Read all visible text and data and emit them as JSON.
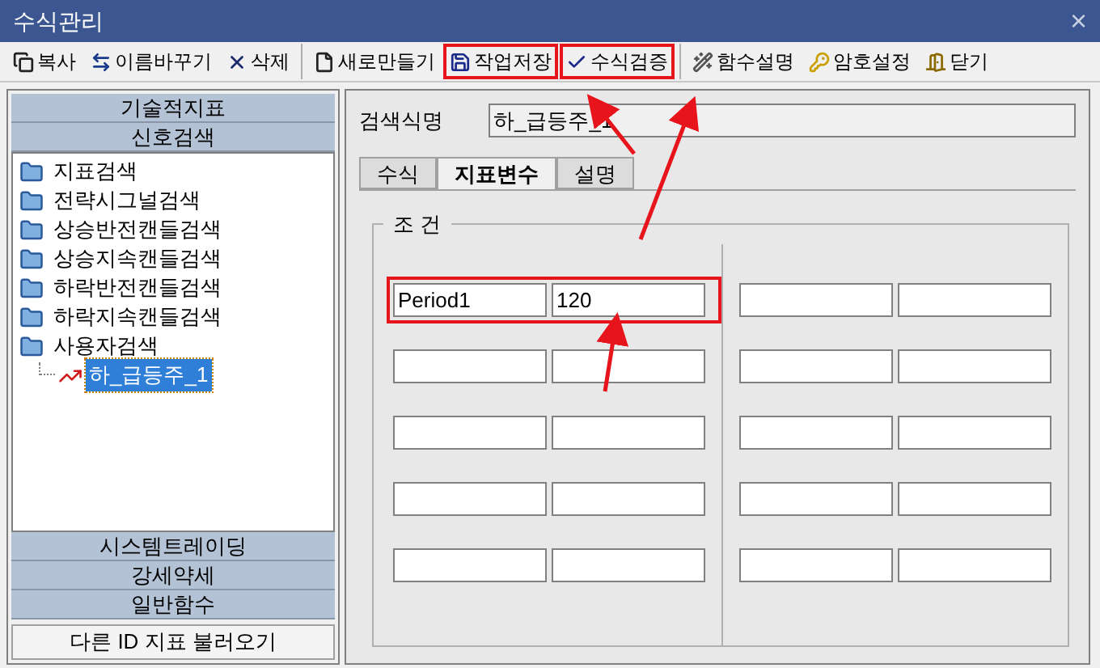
{
  "window": {
    "title": "수식관리",
    "close": "×"
  },
  "toolbar": [
    [
      {
        "label": "복사",
        "highlighted": false
      },
      {
        "label": "이름바꾸기",
        "highlighted": false
      },
      {
        "label": "삭제",
        "highlighted": false
      }
    ],
    [
      {
        "label": "새로만들기",
        "highlighted": false
      },
      {
        "label": "작업저장",
        "highlighted": true
      },
      {
        "label": "수식검증",
        "highlighted": true
      }
    ],
    [
      {
        "label": "함수설명",
        "highlighted": false
      },
      {
        "label": "암호설정",
        "highlighted": false
      },
      {
        "label": "닫기",
        "highlighted": false
      }
    ]
  ],
  "sidebar": {
    "top_sections": [
      "기술적지표",
      "신호검색"
    ],
    "tree": [
      {
        "label": "지표검색",
        "selected": false
      },
      {
        "label": "전략시그널검색",
        "selected": false
      },
      {
        "label": "상승반전캔들검색",
        "selected": false
      },
      {
        "label": "상승지속캔들검색",
        "selected": false
      },
      {
        "label": "하락반전캔들검색",
        "selected": false
      },
      {
        "label": "하락지속캔들검색",
        "selected": false
      },
      {
        "label": "사용자검색",
        "selected": false,
        "children": [
          {
            "label": "하_급등주_1",
            "selected": true
          }
        ]
      }
    ],
    "bottom_sections": [
      "시스템트레이딩",
      "강세약세",
      "일반함수"
    ],
    "load_button": "다른 ID 지표 불러오기"
  },
  "form": {
    "name_label": "검색식명",
    "name_value": "하_급등주_1",
    "tabs": [
      {
        "label": "수식",
        "selected": false
      },
      {
        "label": "지표변수",
        "selected": true
      },
      {
        "label": "설명",
        "selected": false
      }
    ],
    "group_title": "조 건",
    "left_rows": [
      {
        "name": "Period1",
        "value": "120",
        "highlighted": true
      },
      {
        "highlighted": false
      },
      {
        "highlighted": false
      },
      {
        "highlighted": false
      },
      {
        "highlighted": false
      }
    ],
    "right_rows": [
      {
        "highlighted": false
      },
      {
        "highlighted": false
      },
      {
        "highlighted": false
      },
      {
        "highlighted": false
      },
      {
        "highlighted": false
      }
    ]
  }
}
